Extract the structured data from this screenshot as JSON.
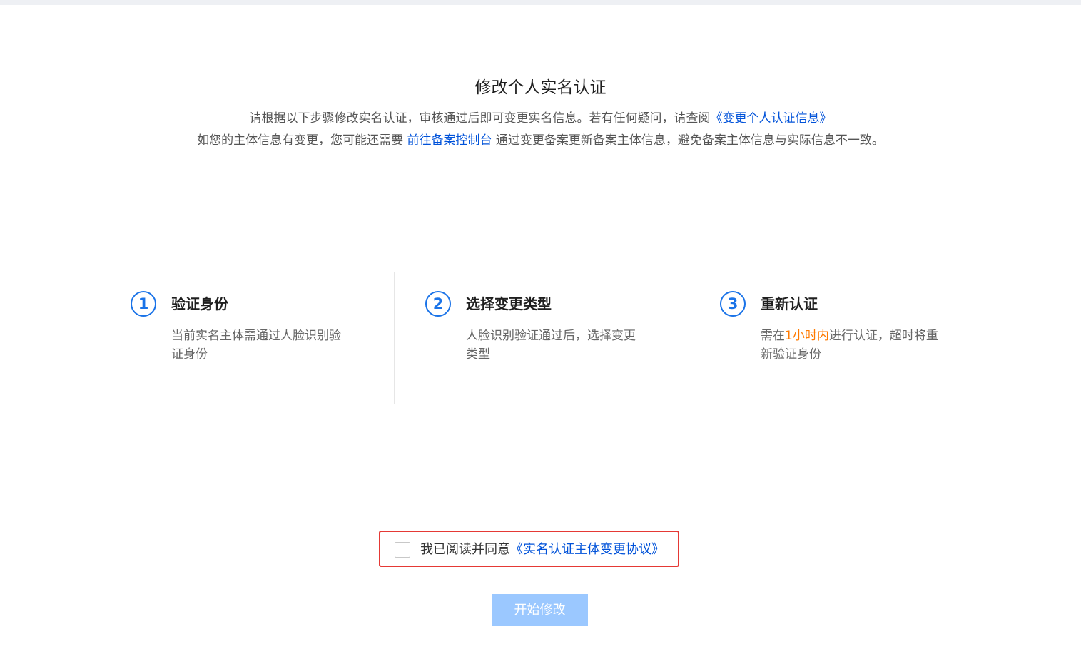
{
  "header": {
    "title": "修改个人实名认证"
  },
  "intro": {
    "line1_text": "请根据以下步骤修改实名认证，审核通过后即可变更实名信息。若有任何疑问，请查阅",
    "line1_link": "《变更个人认证信息》",
    "line2_prefix": "如您的主体信息有变更，您可能还需要 ",
    "line2_link": "前往备案控制台",
    "line2_suffix": " 通过变更备案更新备案主体信息，避免备案主体信息与实际信息不一致。"
  },
  "steps": [
    {
      "number": "1",
      "title": "验证身份",
      "desc": "当前实名主体需通过人脸识别验证身份"
    },
    {
      "number": "2",
      "title": "选择变更类型",
      "desc": "人脸识别验证通过后，选择变更类型"
    },
    {
      "number": "3",
      "title": "重新认证",
      "desc_prefix": "需在",
      "desc_highlight": "1小时内",
      "desc_suffix": "进行认证，超时将重新验证身份"
    }
  ],
  "agreement": {
    "text": "我已阅读并同意",
    "link": "《实名认证主体变更协议》",
    "checked": false
  },
  "actions": {
    "start_label": "开始修改"
  },
  "colors": {
    "link": "#0052d9",
    "step_accent": "#1a73e8",
    "highlight": "#ff7a00",
    "button_disabled": "#9bc8ff",
    "agreement_border": "#e53935"
  }
}
